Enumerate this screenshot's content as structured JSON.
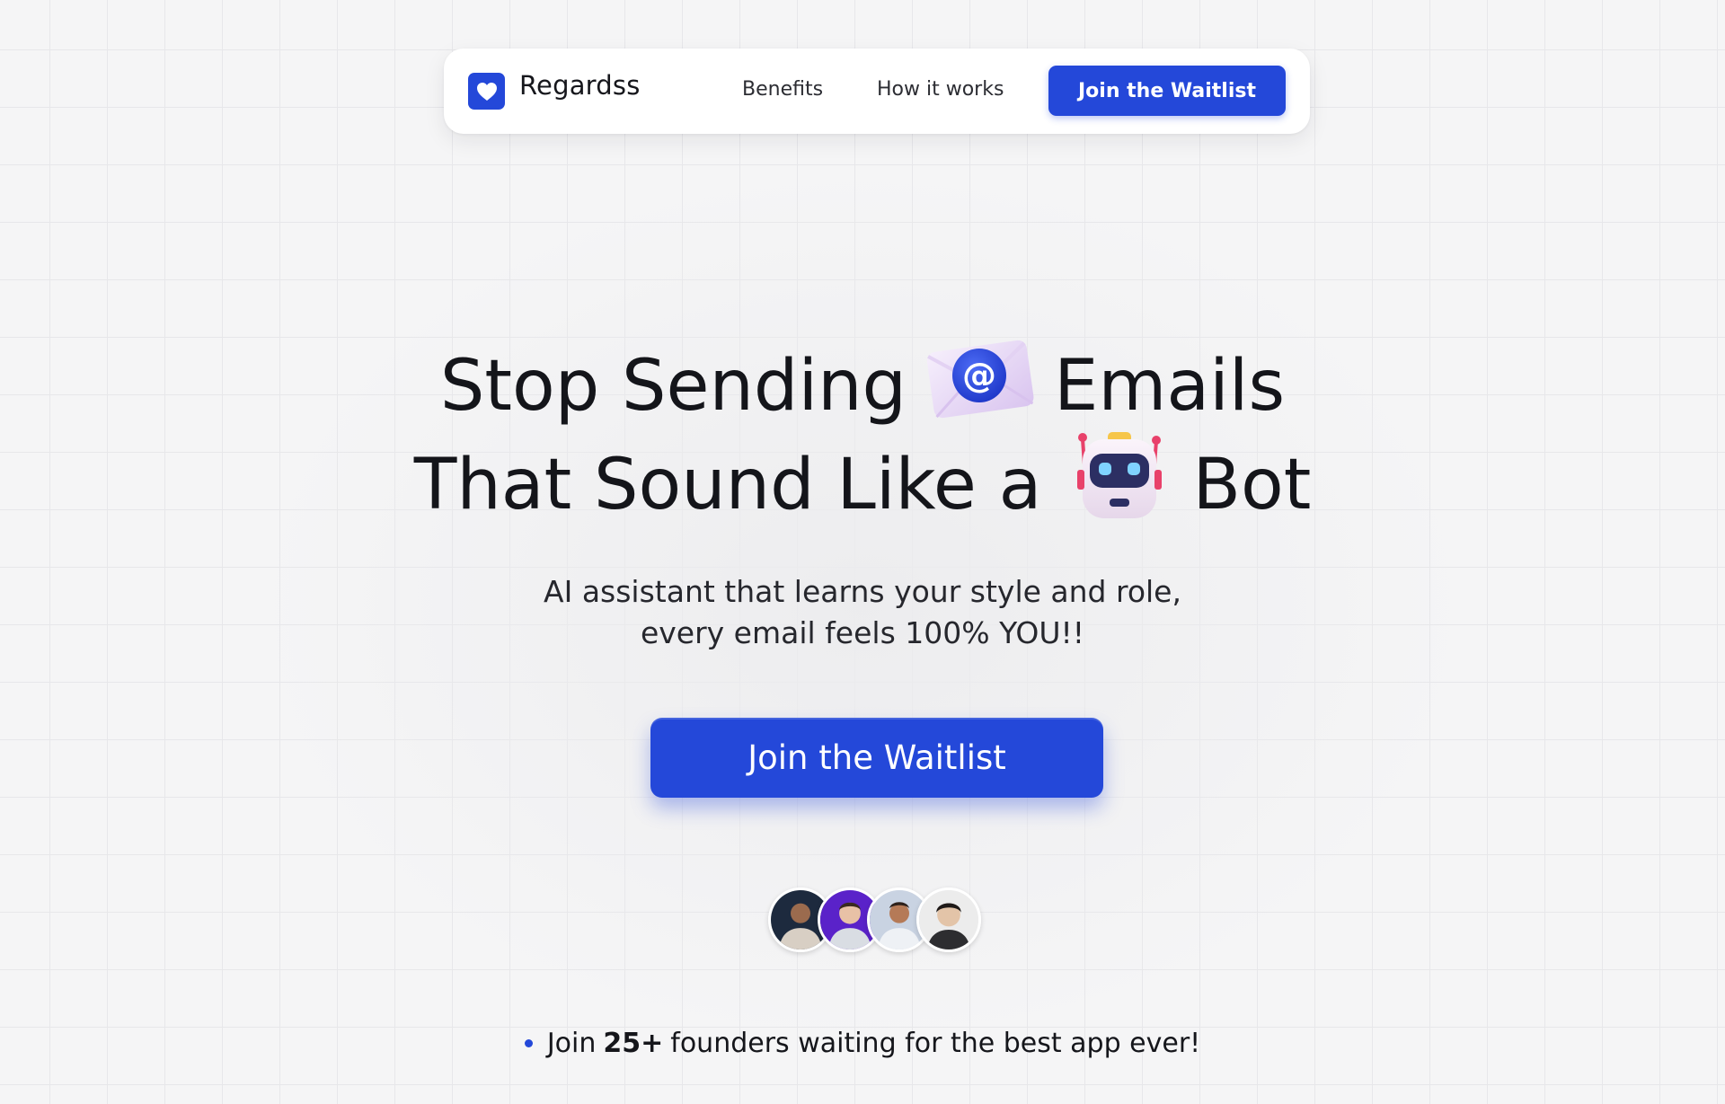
{
  "navbar": {
    "brand": "Regardss",
    "links": [
      "Benefits",
      "How it works"
    ],
    "cta_label": "Join the Waitlist"
  },
  "hero": {
    "line1_start": "Stop Sending",
    "line1_end": "Emails",
    "line2_start": "That Sound Like a",
    "line2_end": "Bot",
    "icons": [
      "envelope-at-icon",
      "robot-icon"
    ],
    "subtitle_line1": "AI assistant that learns your style and role,",
    "subtitle_line2": "every email feels 100% YOU!!",
    "cta_label": "Join the Waitlist"
  },
  "social_proof": {
    "prefix": "Join",
    "count": "25+",
    "suffix": "founders waiting for the best app ever!",
    "avatars": 4
  },
  "colors": {
    "accent": "#2448d9",
    "background": "#f5f5f6",
    "text": "#14151a"
  }
}
